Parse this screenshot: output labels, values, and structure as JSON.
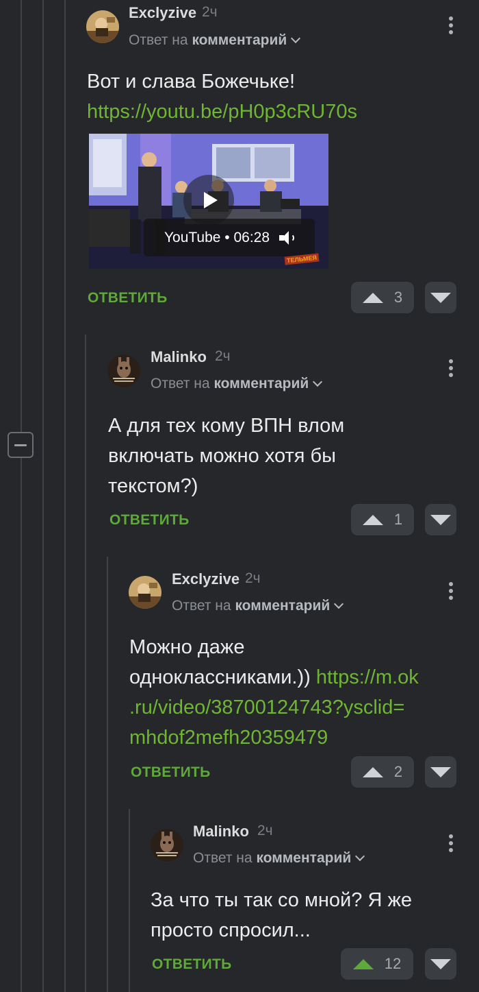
{
  "comments": [
    {
      "author": "Exclyzive",
      "time": "2ч",
      "reply_prefix": "Ответ на",
      "reply_target": "комментарий",
      "text": "Вот и слава Божечьке!",
      "link": "https://youtu.be/pH0p3cRU70s",
      "video": {
        "label": "YouTube • 06:28",
        "icons": [
          "play-icon",
          "speaker-icon"
        ]
      },
      "reply_label": "ОТВЕТИТЬ",
      "votes": "3"
    },
    {
      "author": "Malinko",
      "time": "2ч",
      "reply_prefix": "Ответ на",
      "reply_target": "комментарий",
      "text_line1": "А для тех кому ВПН влом",
      "text_line2": "включать можно хотя бы",
      "text_line3": "текстом?)",
      "reply_label": "ОТВЕТИТЬ",
      "votes": "1"
    },
    {
      "author": "Exclyzive",
      "time": "2ч",
      "reply_prefix": "Ответ на",
      "reply_target": "комментарий",
      "text_line1": "Можно даже",
      "text_line2": "одноклассниками.))",
      "link_line1": "https://m.ok",
      "link_line2": ".ru/video/38700124743?ysclid=",
      "link_line3": "mhdof2mefh20359479",
      "reply_label": "ОТВЕТИТЬ",
      "votes": "2"
    },
    {
      "author": "Malinko",
      "time": "2ч",
      "reply_prefix": "Ответ на",
      "reply_target": "комментарий",
      "text_line1": "За что ты так со мной? Я же",
      "text_line2": "просто спросил...",
      "reply_label": "ОТВЕТИТЬ",
      "votes": "12",
      "upvoted": true
    }
  ],
  "colors": {
    "background": "#25272b",
    "link": "#6fb632",
    "reply": "#5fa83a",
    "vote_bg": "#3a3d41"
  }
}
